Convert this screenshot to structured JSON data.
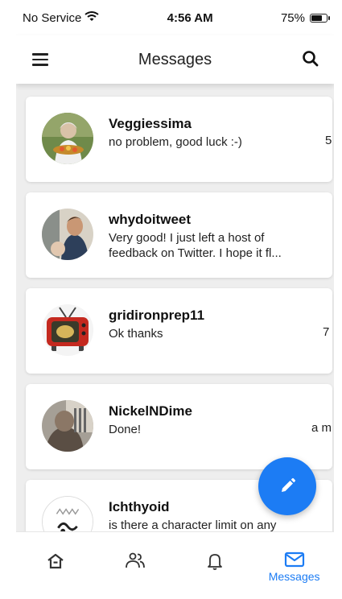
{
  "status_bar": {
    "carrier": "No Service",
    "time": "4:56 AM",
    "battery_percent_label": "75%",
    "battery_level": 0.75
  },
  "header": {
    "title": "Messages",
    "menu_icon": "hamburger-menu-icon",
    "search_icon": "search-icon"
  },
  "conversations": [
    {
      "name": "Veggiessima",
      "preview": "no problem, good luck :-)",
      "meta": "5"
    },
    {
      "name": "whydoitweet",
      "preview": "Very good! I just left a host of feedback on Twitter. I hope it fl...",
      "meta": ""
    },
    {
      "name": "gridironprep11",
      "preview": "Ok thanks",
      "meta": "7"
    },
    {
      "name": "NickelNDime",
      "preview": "Done!",
      "meta": "a m"
    },
    {
      "name": "Ichthyoid",
      "preview": "is there a character limit on any",
      "meta": ""
    }
  ],
  "fab": {
    "icon": "pencil-icon"
  },
  "bottom_nav": {
    "items": [
      {
        "icon": "home-icon",
        "label": ""
      },
      {
        "icon": "people-icon",
        "label": ""
      },
      {
        "icon": "bell-icon",
        "label": ""
      },
      {
        "icon": "mail-icon",
        "label": "Messages"
      }
    ],
    "active_color": "#1c7cf4"
  }
}
